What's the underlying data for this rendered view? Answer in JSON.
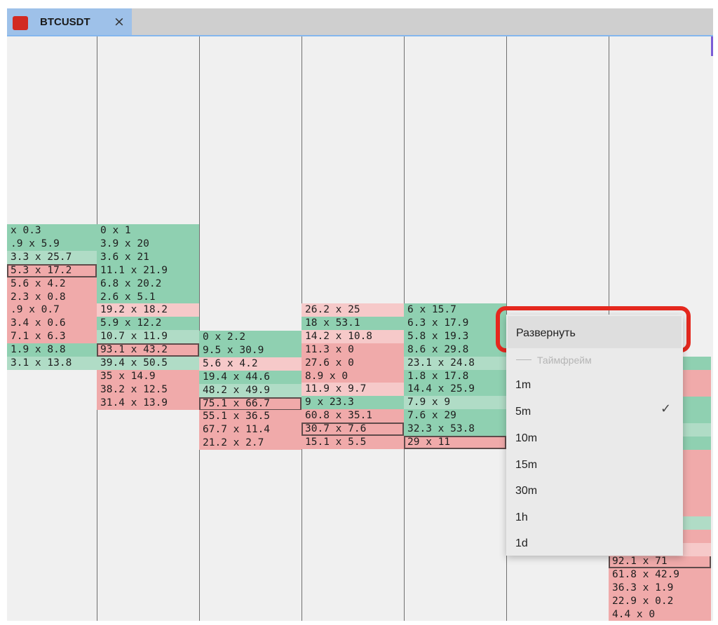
{
  "tab": {
    "title": "BTCUSDT",
    "close_glyph": "×"
  },
  "colors": {
    "bid_green": "#8fd0b1",
    "bid_green_light": "#b0dcc6",
    "ask_red": "#f0aaaa",
    "ask_red_light": "#f6c9c9",
    "callout_red": "#e5281e"
  },
  "footprint": {
    "columns": [
      {
        "cells": [
          {
            "t": "x 0.3",
            "c": "g"
          },
          {
            "t": ".9 x 5.9",
            "c": "g"
          },
          {
            "t": "3.3 x 25.7",
            "c": "lg"
          },
          {
            "t": "5.3 x 17.2",
            "c": "r",
            "hl": true
          },
          {
            "t": "5.6 x 4.2",
            "c": "r"
          },
          {
            "t": "2.3 x 0.8",
            "c": "r"
          },
          {
            "t": ".9 x 0.7",
            "c": "r"
          },
          {
            "t": "3.4 x 0.6",
            "c": "r"
          },
          {
            "t": "7.1 x 6.3",
            "c": "r"
          },
          {
            "t": "1.9 x 8.8",
            "c": "g"
          },
          {
            "t": "3.1 x 13.8",
            "c": "lg"
          }
        ]
      },
      {
        "cells": [
          {
            "t": "0 x 1",
            "c": "g"
          },
          {
            "t": "3.9 x 20",
            "c": "g"
          },
          {
            "t": "3.6 x 21",
            "c": "g"
          },
          {
            "t": "11.1 x 21.9",
            "c": "g"
          },
          {
            "t": "6.8 x 20.2",
            "c": "g"
          },
          {
            "t": "2.6 x 5.1",
            "c": "g"
          },
          {
            "t": "19.2 x 18.2",
            "c": "lr"
          },
          {
            "t": "5.9 x 12.2",
            "c": "g"
          },
          {
            "t": "10.7 x 11.9",
            "c": "lg"
          },
          {
            "t": "93.1 x 43.2",
            "c": "r",
            "hl": true
          },
          {
            "t": "39.4 x 50.5",
            "c": "lg"
          },
          {
            "t": "35 x 14.9",
            "c": "r"
          },
          {
            "t": "38.2 x 12.5",
            "c": "r"
          },
          {
            "t": "31.4 x 13.9",
            "c": "r"
          }
        ]
      },
      {
        "cells": [
          {
            "t": "0 x 2.2",
            "c": "g"
          },
          {
            "t": "9.5 x 30.9",
            "c": "g"
          },
          {
            "t": "5.6 x 4.2",
            "c": "lr"
          },
          {
            "t": "19.4 x 44.6",
            "c": "g"
          },
          {
            "t": "48.2 x 49.9",
            "c": "lg"
          },
          {
            "t": "75.1 x 66.7",
            "c": "r",
            "hl": true
          },
          {
            "t": "55.1 x 36.5",
            "c": "r"
          },
          {
            "t": "67.7 x 11.4",
            "c": "r"
          },
          {
            "t": "21.2 x 2.7",
            "c": "r"
          }
        ]
      },
      {
        "cells": [
          {
            "t": "26.2 x 25",
            "c": "lr"
          },
          {
            "t": "18 x 53.1",
            "c": "g"
          },
          {
            "t": "14.2 x 10.8",
            "c": "lr"
          },
          {
            "t": "11.3 x 0",
            "c": "r"
          },
          {
            "t": "27.6 x 0",
            "c": "r"
          },
          {
            "t": "8.9 x 0",
            "c": "r"
          },
          {
            "t": "11.9 x 9.7",
            "c": "lr"
          },
          {
            "t": "9 x 23.3",
            "c": "g"
          },
          {
            "t": "60.8 x 35.1",
            "c": "r"
          },
          {
            "t": "30.7 x 7.6",
            "c": "r",
            "hl": true
          },
          {
            "t": "15.1 x 5.5",
            "c": "r"
          }
        ]
      },
      {
        "cells": [
          {
            "t": "6 x 15.7",
            "c": "g"
          },
          {
            "t": "6.3 x 17.9",
            "c": "g"
          },
          {
            "t": "5.8 x 19.3",
            "c": "g"
          },
          {
            "t": "8.6 x 29.8",
            "c": "g"
          },
          {
            "t": "23.1 x 24.8",
            "c": "lg"
          },
          {
            "t": "1.8 x 17.8",
            "c": "g"
          },
          {
            "t": "14.4 x 25.9",
            "c": "g"
          },
          {
            "t": "7.9 x 9",
            "c": "lg"
          },
          {
            "t": "7.6 x 29",
            "c": "g"
          },
          {
            "t": "32.3 x 53.8",
            "c": "g"
          },
          {
            "t": "29 x 11",
            "c": "r",
            "hl": true
          }
        ]
      },
      {
        "cells": []
      },
      {
        "cells": [
          {
            "t": "92.1 x 71",
            "c": "r",
            "hl": true
          },
          {
            "t": "61.8 x 42.9",
            "c": "r"
          },
          {
            "t": "36.3 x 1.9",
            "c": "r"
          },
          {
            "t": "22.9 x 0.2",
            "c": "r"
          },
          {
            "t": "4.4 x 0",
            "c": "r"
          }
        ]
      }
    ]
  },
  "menu": {
    "expand": "Развернуть",
    "section": "Таймфрейм",
    "items": [
      "1m",
      "5m",
      "10m",
      "15m",
      "30m",
      "1h",
      "1d"
    ],
    "selected": "5m",
    "check_glyph": "✓"
  }
}
